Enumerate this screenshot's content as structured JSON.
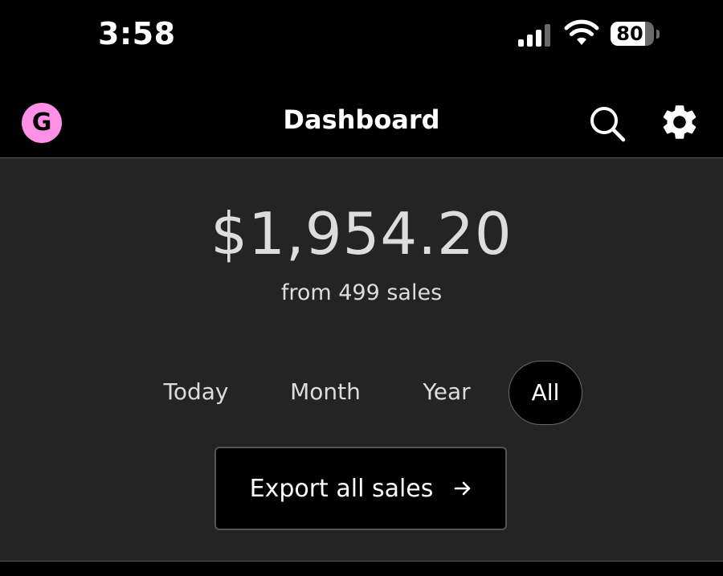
{
  "status_bar": {
    "time": "3:58",
    "battery_level": "80",
    "battery_fraction": 0.8,
    "signal_icon": "cellular-signal-icon",
    "wifi_icon": "wifi-icon"
  },
  "header": {
    "avatar_initial": "G",
    "title": "Dashboard",
    "search_icon": "search-icon",
    "settings_icon": "gear-icon"
  },
  "summary": {
    "total": "$1,954.20",
    "subtitle": "from 499 sales"
  },
  "period_tabs": [
    {
      "label": "Today",
      "active": false
    },
    {
      "label": "Month",
      "active": false
    },
    {
      "label": "Year",
      "active": false
    },
    {
      "label": "All",
      "active": true
    }
  ],
  "export": {
    "label": "Export all sales",
    "icon": "arrow-right-icon"
  },
  "colors": {
    "avatar_bg": "#ff90e8",
    "main_bg": "#242424",
    "header_bg": "#000000"
  }
}
